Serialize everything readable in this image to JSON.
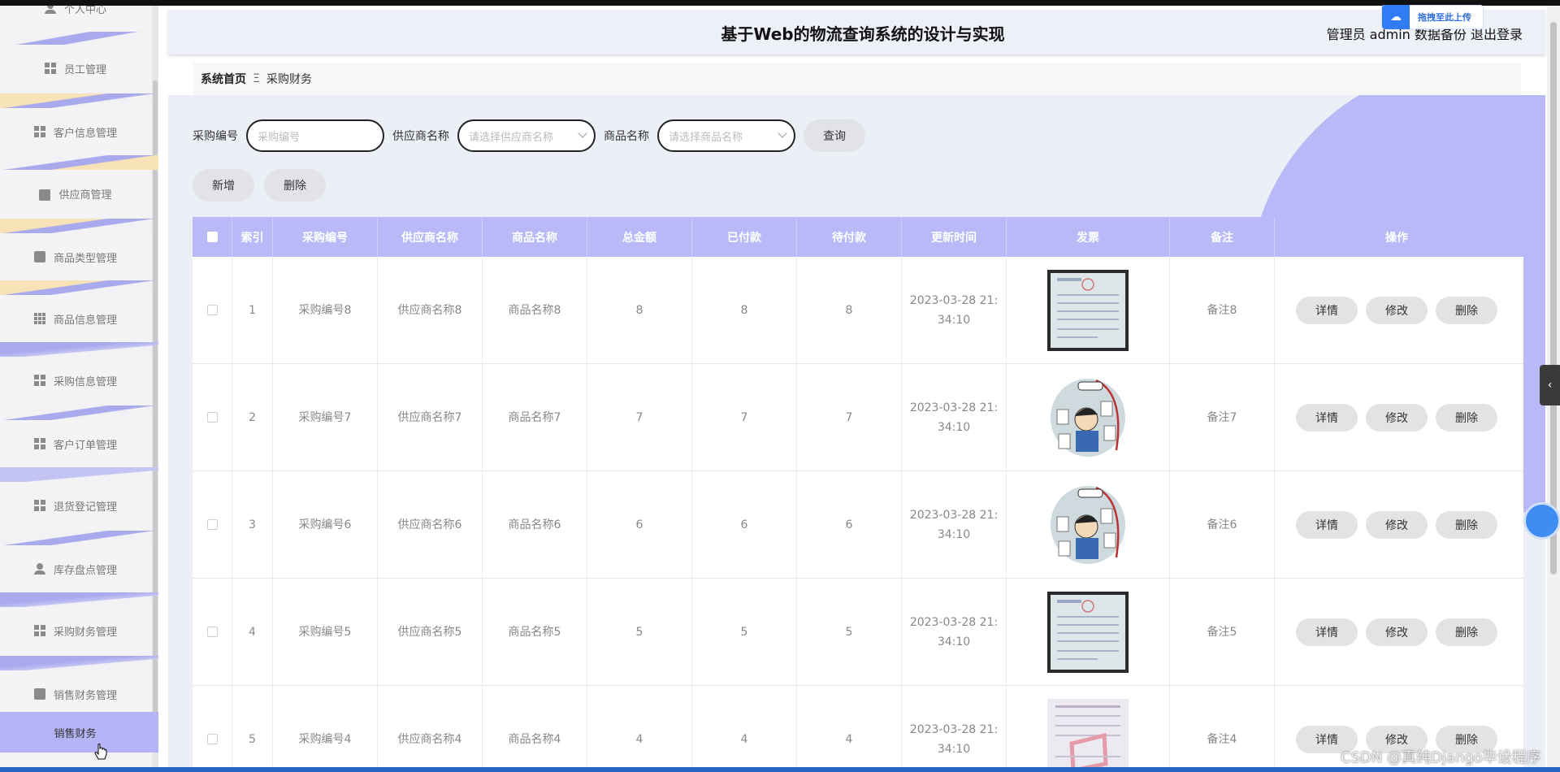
{
  "header": {
    "title": "基于Web的物流查询系统的设计与实现",
    "user_text": "管理员 admin  数据备份  退出登录",
    "upload_badge": "拖拽至此上传"
  },
  "sidebar": {
    "items": [
      {
        "label": "个人中心",
        "icon": "user-icon"
      },
      {
        "label": "员工管理",
        "icon": "grid-icon"
      },
      {
        "label": "客户信息管理",
        "icon": "grid-icon"
      },
      {
        "label": "供应商管理",
        "icon": "briefcase-icon"
      },
      {
        "label": "商品类型管理",
        "icon": "clipboard-icon"
      },
      {
        "label": "商品信息管理",
        "icon": "grid9-icon"
      },
      {
        "label": "采购信息管理",
        "icon": "grid-icon"
      },
      {
        "label": "客户订单管理",
        "icon": "grid-icon"
      },
      {
        "label": "退货登记管理",
        "icon": "grid-icon"
      },
      {
        "label": "库存盘点管理",
        "icon": "user-icon"
      },
      {
        "label": "采购财务管理",
        "icon": "grid-icon"
      },
      {
        "label": "销售财务管理",
        "icon": "checklist-icon"
      },
      {
        "label": "销售财务",
        "icon": ""
      }
    ]
  },
  "breadcrumb": {
    "home": "系统首页",
    "sep": "Ξ",
    "current": "采购财务"
  },
  "search": {
    "purchase_no_label": "采购编号",
    "purchase_no_placeholder": "采购编号",
    "supplier_label": "供应商名称",
    "supplier_placeholder": "请选择供应商名称",
    "product_label": "商品名称",
    "product_placeholder": "请选择商品名称",
    "query_button": "查询"
  },
  "actions": {
    "add": "新增",
    "delete": "删除"
  },
  "table": {
    "headers": [
      "",
      "索引",
      "采购编号",
      "供应商名称",
      "商品名称",
      "总金额",
      "已付款",
      "待付款",
      "更新时间",
      "发票",
      "备注",
      "操作"
    ],
    "row_buttons": {
      "detail": "详情",
      "edit": "修改",
      "delete": "删除"
    },
    "rows": [
      {
        "index": "1",
        "purchase_no": "采购编号8",
        "supplier": "供应商名称8",
        "product": "商品名称8",
        "total": "8",
        "paid": "8",
        "pending": "8",
        "time_a": "2023-03-28 21:",
        "time_b": "34:10",
        "invoice": "invoice-image",
        "note": "备注8"
      },
      {
        "index": "2",
        "purchase_no": "采购编号7",
        "supplier": "供应商名称7",
        "product": "商品名称7",
        "total": "7",
        "paid": "7",
        "pending": "7",
        "time_a": "2023-03-28 21:",
        "time_b": "34:10",
        "invoice": "cartoon-image",
        "note": "备注7"
      },
      {
        "index": "3",
        "purchase_no": "采购编号6",
        "supplier": "供应商名称6",
        "product": "商品名称6",
        "total": "6",
        "paid": "6",
        "pending": "6",
        "time_a": "2023-03-28 21:",
        "time_b": "34:10",
        "invoice": "cartoon-image",
        "note": "备注6"
      },
      {
        "index": "4",
        "purchase_no": "采购编号5",
        "supplier": "供应商名称5",
        "product": "商品名称5",
        "total": "5",
        "paid": "5",
        "pending": "5",
        "time_a": "2023-03-28 21:",
        "time_b": "34:10",
        "invoice": "invoice-image",
        "note": "备注5"
      },
      {
        "index": "5",
        "purchase_no": "采购编号4",
        "supplier": "供应商名称4",
        "product": "商品名称4",
        "total": "4",
        "paid": "4",
        "pending": "4",
        "time_a": "2023-03-28 21:",
        "time_b": "34:10",
        "invoice": "sample-invoice-image",
        "note": "备注4"
      }
    ]
  },
  "watermark": "CSDN @真纯Django毕设程序",
  "colors": {
    "accent": "#b9b9f7",
    "sidebar_active": "#b4b4f6",
    "header_bg": "#eef0f8"
  }
}
